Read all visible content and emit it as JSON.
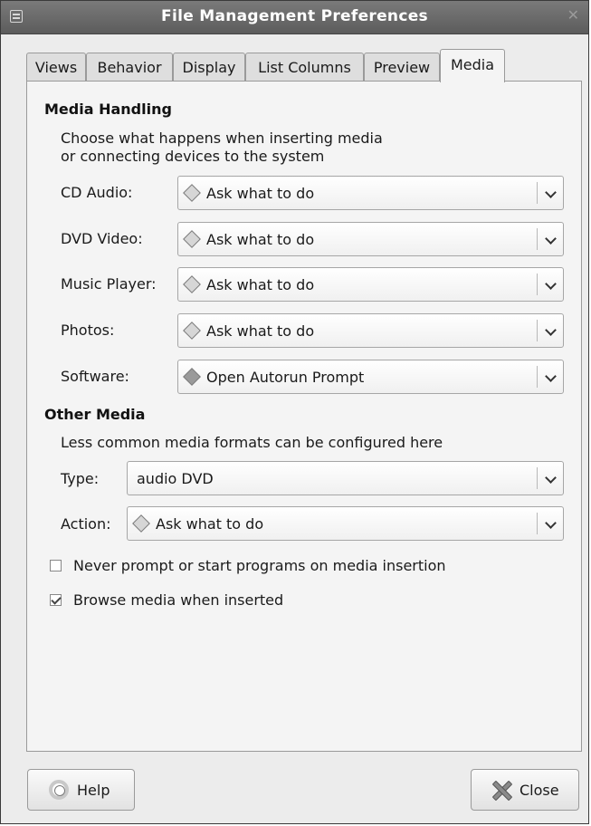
{
  "window": {
    "title": "File Management Preferences"
  },
  "tabs": [
    {
      "label": "Views"
    },
    {
      "label": "Behavior"
    },
    {
      "label": "Display"
    },
    {
      "label": "List Columns"
    },
    {
      "label": "Preview"
    },
    {
      "label": "Media",
      "active": true
    }
  ],
  "media_handling": {
    "title": "Media Handling",
    "description_line1": "Choose what happens when inserting media",
    "description_line2": "or connecting devices to the system",
    "rows": [
      {
        "label": "CD Audio:",
        "value": "Ask what to do",
        "icon": "ask-diamond-icon"
      },
      {
        "label": "DVD Video:",
        "value": "Ask what to do",
        "icon": "ask-diamond-icon"
      },
      {
        "label": "Music Player:",
        "value": "Ask what to do",
        "icon": "ask-diamond-icon"
      },
      {
        "label": "Photos:",
        "value": "Ask what to do",
        "icon": "ask-diamond-icon"
      },
      {
        "label": "Software:",
        "value": "Open Autorun Prompt",
        "icon": "autorun-diamond-icon"
      }
    ]
  },
  "other_media": {
    "title": "Other Media",
    "description": "Less common media formats can be configured here",
    "type_label": "Type:",
    "type_value": "audio DVD",
    "action_label": "Action:",
    "action_value": "Ask what to do"
  },
  "options": {
    "never_prompt": {
      "label": "Never prompt or start programs on media insertion",
      "checked": false
    },
    "browse_media": {
      "label": "Browse media when inserted",
      "checked": true
    }
  },
  "buttons": {
    "help": "Help",
    "close": "Close"
  },
  "colors": {
    "titlebar": "#6a6a6a",
    "window_bg": "#ececec",
    "panel_bg": "#f4f4f4"
  }
}
